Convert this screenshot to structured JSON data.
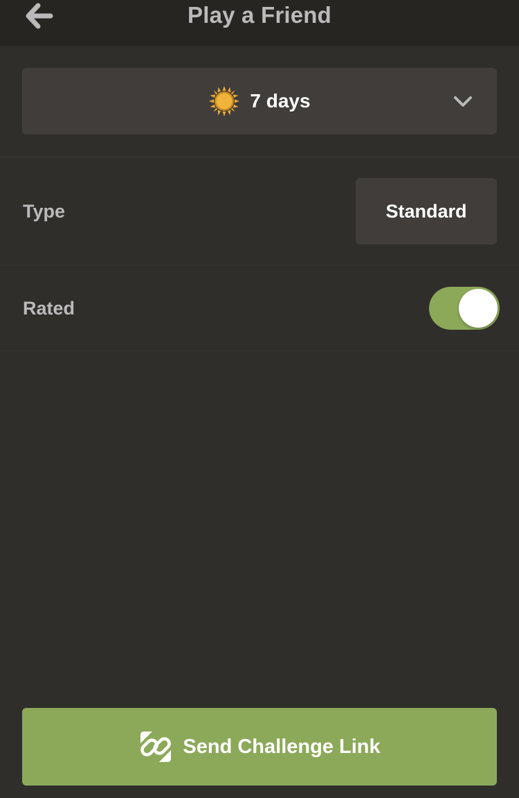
{
  "header": {
    "title": "Play a Friend",
    "back_icon": "arrow-left-icon"
  },
  "time_control": {
    "icon": "sun-icon",
    "icon_color": "#e9a93a",
    "label": "7 days",
    "dropdown_icon": "chevron-down-icon"
  },
  "type_row": {
    "label": "Type",
    "value": "Standard"
  },
  "rated_row": {
    "label": "Rated",
    "toggle_on": true,
    "toggle_color": "#8ca95a"
  },
  "send_button": {
    "icon": "link-icon",
    "label": "Send Challenge Link",
    "color": "#8ca95a"
  }
}
